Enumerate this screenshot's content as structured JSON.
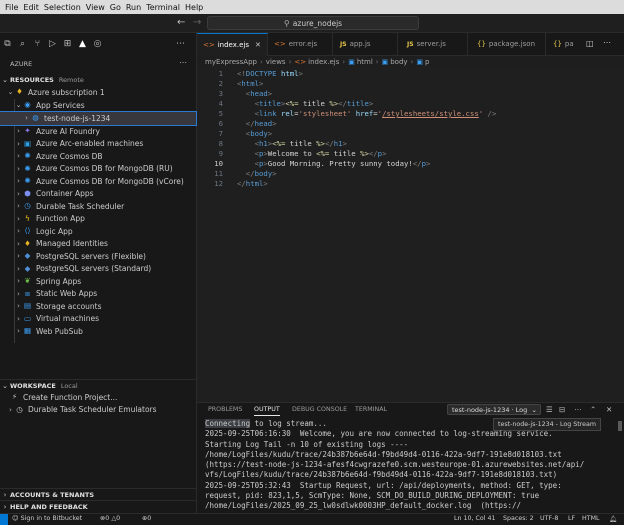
{
  "menu": [
    "File",
    "Edit",
    "Selection",
    "View",
    "Go",
    "Run",
    "Terminal",
    "Help"
  ],
  "title_search": "azure_nodejs",
  "sidebar": {
    "title": "AZURE",
    "resources_header": "RESOURCES",
    "resources_sub": "Remote",
    "subscription": "Azure subscription 1",
    "app_services": "App Services",
    "selected_app": "test-node-js-1234",
    "items": [
      "Azure AI Foundry",
      "Azure Arc-enabled machines",
      "Azure Cosmos DB",
      "Azure Cosmos DB for MongoDB (RU)",
      "Azure Cosmos DB for MongoDB (vCore)",
      "Container Apps",
      "Durable Task Scheduler",
      "Function App",
      "Logic App",
      "Managed Identities",
      "PostgreSQL servers (Flexible)",
      "PostgreSQL servers (Standard)",
      "Spring Apps",
      "Static Web Apps",
      "Storage accounts",
      "Virtual machines",
      "Web PubSub"
    ],
    "workspace_header": "WORKSPACE",
    "workspace_sub": "Local",
    "workspace_items": [
      "Create Function Project...",
      "Durable Task Scheduler Emulators"
    ],
    "accounts_header": "ACCOUNTS & TENANTS",
    "help_header": "HELP AND FEEDBACK"
  },
  "tabs": [
    {
      "label": "index.ejs",
      "icon": "<>"
    },
    {
      "label": "error.ejs",
      "icon": "<>"
    },
    {
      "label": "app.js",
      "icon": "JS"
    },
    {
      "label": "server.js",
      "icon": "JS"
    },
    {
      "label": "package.json",
      "icon": "{}"
    },
    {
      "label": "pa",
      "icon": "{}"
    }
  ],
  "breadcrumb": [
    "myExpressApp",
    "views",
    "index.ejs",
    "html",
    "body",
    "p"
  ],
  "code": {
    "lines": [
      "1",
      "2",
      "3",
      "4",
      "5",
      "6",
      "7",
      "8",
      "9",
      "10",
      "11",
      "12"
    ],
    "current_line": "10"
  },
  "panel": {
    "tabs": [
      "PROBLEMS",
      "OUTPUT",
      "DEBUG CONSOLE",
      "TERMINAL"
    ],
    "active_tab": "OUTPUT",
    "stream_select": "test-node-js-1234 · Log",
    "tooltip": "test-node-js-1234 - Log Stream",
    "terminal_first_highlight": "Connecting",
    "terminal_first_rest": " to log stream...",
    "terminal_lines": [
      "2025-09-25T06:16:30  Welcome, you are now connected to log-streaming service.",
      "Starting Log Tail -n 10 of existing logs ----",
      "/home/LogFiles/kudu/trace/24b387b6e64d-f9bd49d4-0116-422a-9df7-191e8d018103.txt",
      "(https://test-node-js-1234-afesf4cwgrazefe0.scm.westeurope-01.azurewebsites.net/api/",
      "vfs/LogFiles/kudu/trace/24b387b6e64d-f9bd49d4-0116-422a-9df7-191e8d018103.txt)",
      "2025-09-25T05:32:43  Startup Request, url: /api/deployments, method: GET, type:",
      "request, pid: 823,1,5, ScmType: None, SCM_DO_BUILD_DURING_DEPLOYMENT: true",
      "/home/LogFiles/2025_09_25_lw0sdlwk0003HP_default_docker.log  (https://"
    ]
  },
  "status": {
    "signin": "Sign in to Bitbucket",
    "problems": "0",
    "warnings": "0",
    "infos": "0",
    "position": "Ln 10, Col 41",
    "spaces": "Spaces: 2",
    "encoding": "UTF-8",
    "eol": "LF",
    "language": "HTML"
  }
}
